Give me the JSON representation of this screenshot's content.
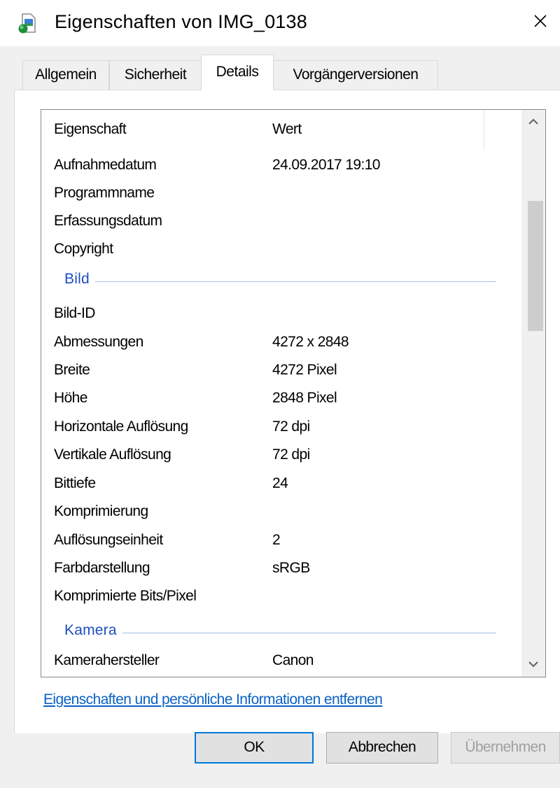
{
  "window": {
    "title": "Eigenschaften von IMG_0138",
    "icon": "image-file-icon",
    "close_icon": "close-icon"
  },
  "tabs": [
    {
      "label": "Allgemein",
      "active": false
    },
    {
      "label": "Sicherheit",
      "active": false
    },
    {
      "label": "Details",
      "active": true
    },
    {
      "label": "Vorgängerversionen",
      "active": false
    }
  ],
  "details": {
    "columns": {
      "name": "Eigenschaft",
      "value": "Wert"
    },
    "rows": [
      {
        "name": "Aufnahmedatum",
        "value": "24.09.2017 19:10"
      },
      {
        "name": "Programmname",
        "value": ""
      },
      {
        "name": "Erfassungsdatum",
        "value": ""
      },
      {
        "name": "Copyright",
        "value": ""
      }
    ],
    "group_image": "Bild",
    "image_rows": [
      {
        "name": "Bild-ID",
        "value": ""
      },
      {
        "name": "Abmessungen",
        "value": "4272 x 2848"
      },
      {
        "name": "Breite",
        "value": "4272 Pixel"
      },
      {
        "name": "Höhe",
        "value": "2848 Pixel"
      },
      {
        "name": "Horizontale Auflösung",
        "value": "72 dpi"
      },
      {
        "name": "Vertikale Auflösung",
        "value": "72 dpi"
      },
      {
        "name": "Bittiefe",
        "value": "24"
      },
      {
        "name": "Komprimierung",
        "value": ""
      },
      {
        "name": "Auflösungseinheit",
        "value": "2"
      },
      {
        "name": "Farbdarstellung",
        "value": "sRGB"
      },
      {
        "name": "Komprimierte Bits/Pixel",
        "value": ""
      }
    ],
    "group_camera": "Kamera",
    "camera_rows": [
      {
        "name": "Kamerahersteller",
        "value": "Canon"
      }
    ]
  },
  "remove_properties_link": "Eigenschaften und persönliche Informationen entfernen",
  "buttons": {
    "ok": "OK",
    "cancel": "Abbrechen",
    "apply": "Übernehmen"
  },
  "colors": {
    "accent": "#0078d7",
    "link": "#0b62c4",
    "group_heading": "#1e4fbf"
  }
}
